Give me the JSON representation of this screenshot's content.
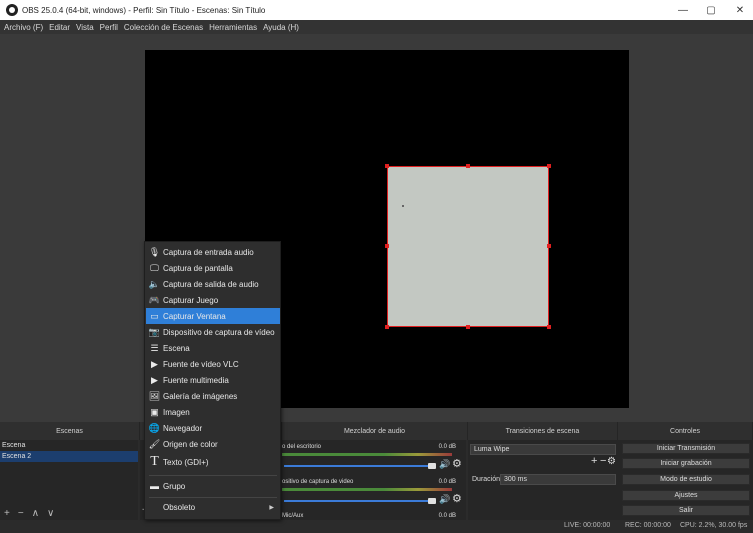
{
  "window": {
    "title": "OBS 25.0.4 (64-bit, windows) - Perfil: Sin Título - Escenas: Sin Título",
    "minimize": "—",
    "maximize": "▢",
    "close": "✕"
  },
  "menubar": [
    "Archivo (F)",
    "Editar",
    "Vista",
    "Perfil",
    "Colección de Escenas",
    "Herramientas",
    "Ayuda (H)"
  ],
  "docks": {
    "scenes_title": "Escenas",
    "mixer_title": "Mezclador de audio",
    "transitions_title": "Transiciones de escena",
    "controls_title": "Controles"
  },
  "scenes": [
    {
      "name": "Escena",
      "active": false
    },
    {
      "name": "Escena 2",
      "active": true
    }
  ],
  "scene_toolbar": {
    "add": "+",
    "remove": "−",
    "up": "∧",
    "down": "∨"
  },
  "mixer": {
    "tracks": [
      {
        "name": "o del escritorio",
        "db": "0.0 dB"
      },
      {
        "name": "ositivo de captura de video",
        "db": "0.0 dB"
      },
      {
        "name": "Mic/Aux",
        "db": "0.0 dB"
      }
    ]
  },
  "transitions": {
    "selected": "Luma Wipe",
    "duration_label": "Duración",
    "duration_value": "300 ms"
  },
  "controls": [
    "Iniciar Transmisión",
    "Iniciar grabación",
    "Modo de estudio",
    "Ajustes",
    "Salir"
  ],
  "context_menu": {
    "items": [
      {
        "label": "Captura de entrada audio",
        "icon": "microphone-icon"
      },
      {
        "label": "Captura de pantalla",
        "icon": "monitor-icon"
      },
      {
        "label": "Captura de salida de audio",
        "icon": "speaker-icon"
      },
      {
        "label": "Capturar Juego",
        "icon": "gamepad-icon"
      },
      {
        "label": "Capturar Ventana",
        "icon": "window-icon",
        "selected": true
      },
      {
        "label": "Dispositivo de captura de vídeo",
        "icon": "camera-icon"
      },
      {
        "label": "Escena",
        "icon": "list-icon"
      },
      {
        "label": "Fuente de vídeo VLC",
        "icon": "play-icon"
      },
      {
        "label": "Fuente multimedia",
        "icon": "play-icon"
      },
      {
        "label": "Galería de imágenes",
        "icon": "gallery-icon"
      },
      {
        "label": "Imagen",
        "icon": "image-icon"
      },
      {
        "label": "Navegador",
        "icon": "globe-icon"
      },
      {
        "label": "Origen de color",
        "icon": "brush-icon"
      },
      {
        "label": "Texto (GDI+)",
        "icon": "text-icon"
      }
    ],
    "group": "Grupo",
    "deprecated": "Obsoleto"
  },
  "status": {
    "live": "LIVE: 00:00:00",
    "rec": "REC: 00:00:00",
    "cpu": "CPU: 2.2%, 30.00 fps"
  },
  "colors": {
    "accent": "#2f7fd8",
    "selection_outline": "#e02020",
    "source_fill": "#c3c8c2"
  }
}
